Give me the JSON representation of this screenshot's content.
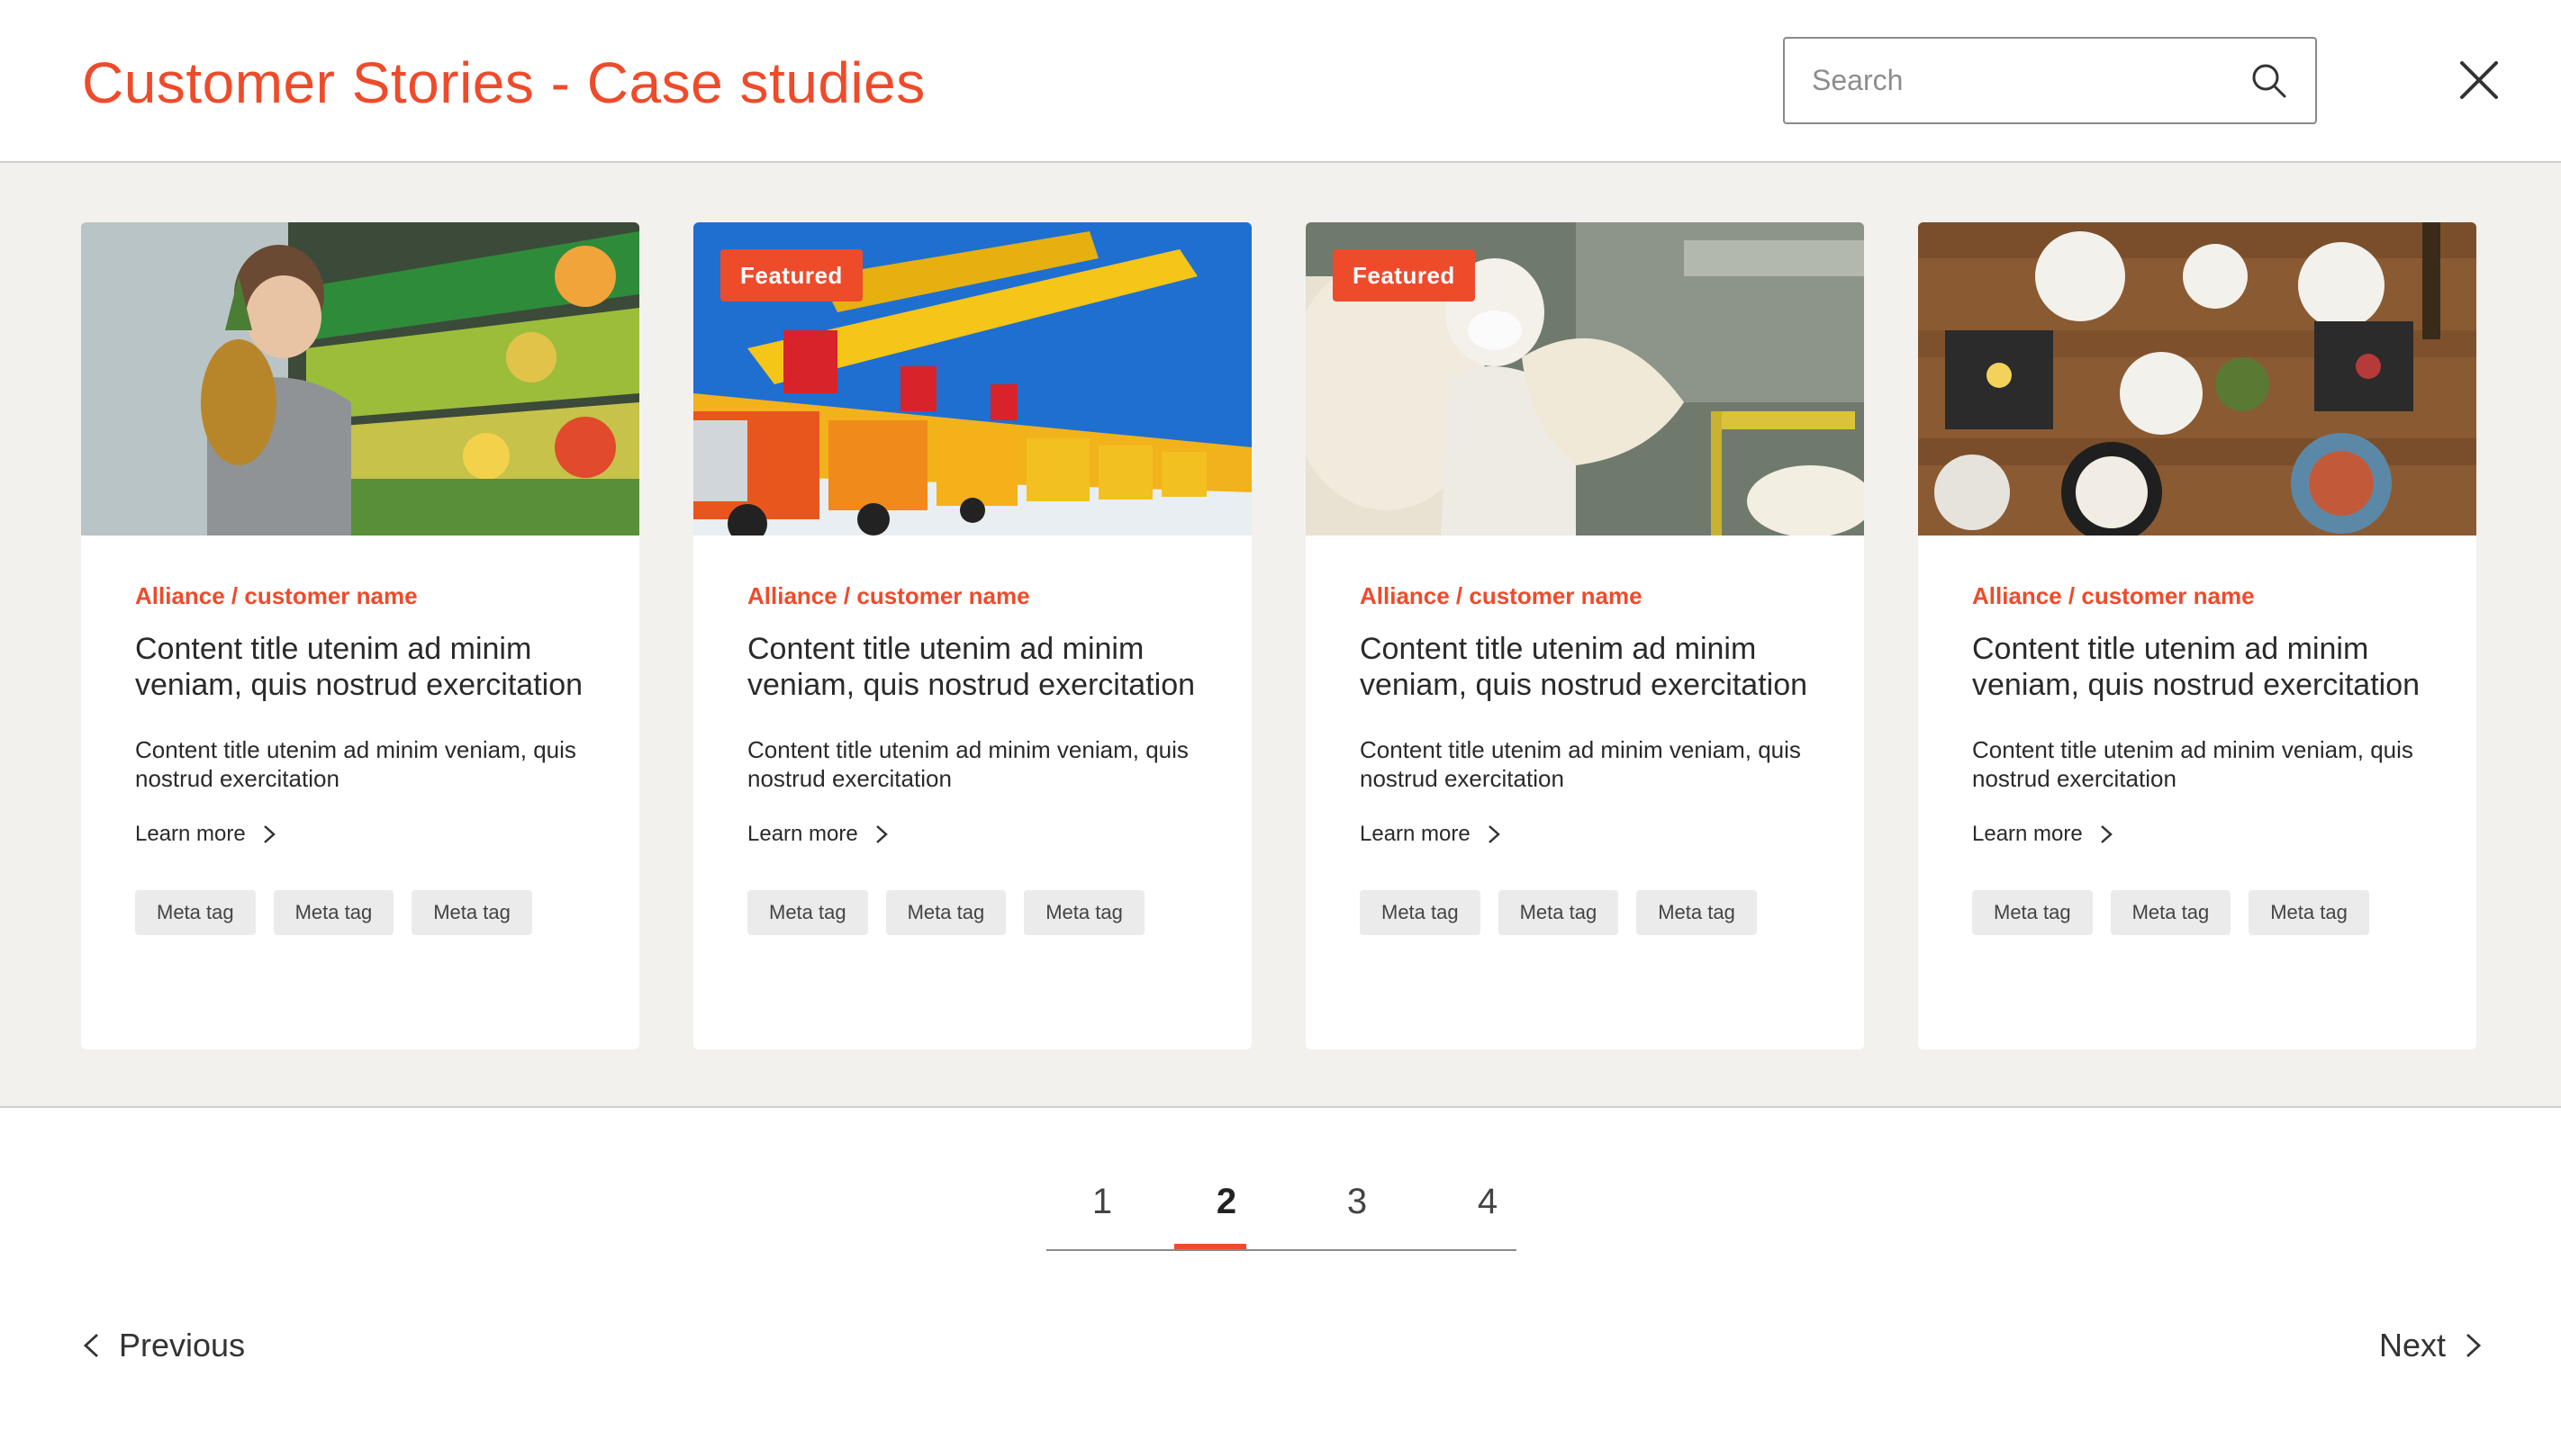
{
  "header": {
    "title": "Customer Stories - Case studies",
    "search_placeholder": "Search",
    "search_value": ""
  },
  "cards": [
    {
      "image": "child holding pineapple in grocery produce aisle",
      "featured": null,
      "customer": "Alliance / customer name",
      "title": "Content title utenim ad minim veniam, quis nostrud exercitation",
      "description": "Content title utenim ad minim veniam, quis nostrud exercitation",
      "link": "Learn more",
      "tags": [
        "Meta tag",
        "Meta tag",
        "Meta tag"
      ]
    },
    {
      "image": "row of yellow cranes on trucks under blue sky",
      "featured": "Featured",
      "customer": "Alliance / customer name",
      "title": "Content title utenim ad minim veniam, quis nostrud exercitation",
      "description": "Content title utenim ad minim veniam, quis nostrud exercitation",
      "link": "Learn more",
      "tags": [
        "Meta tag",
        "Meta tag",
        "Meta tag"
      ]
    },
    {
      "image": "worker in mask handling raw wool in factory",
      "featured": "Featured",
      "customer": "Alliance / customer name",
      "title": "Content title utenim ad minim veniam, quis nostrud exercitation",
      "description": "Content title utenim ad minim veniam, quis nostrud exercitation",
      "link": "Learn more",
      "tags": [
        "Meta tag",
        "Meta tag",
        "Meta tag"
      ]
    },
    {
      "image": "overhead view of food platters on wooden table",
      "featured": null,
      "customer": "Alliance / customer name",
      "title": "Content title utenim ad minim veniam, quis nostrud exercitation",
      "description": "Content title utenim ad minim veniam, quis nostrud exercitation",
      "link": "Learn more",
      "tags": [
        "Meta tag",
        "Meta tag",
        "Meta tag"
      ]
    }
  ],
  "pagination": {
    "pages": [
      "1",
      "2",
      "3",
      "4"
    ],
    "current": "2",
    "previous_label": "Previous",
    "next_label": "Next"
  },
  "colors": {
    "accent": "#ee4b2b",
    "band_background": "#f2f1ee",
    "tag_background": "#ebebeb"
  },
  "icons": {
    "search": "search-icon",
    "close": "close-icon",
    "chevron_right": "chevron-right-icon",
    "chevron_left": "chevron-left-icon"
  }
}
